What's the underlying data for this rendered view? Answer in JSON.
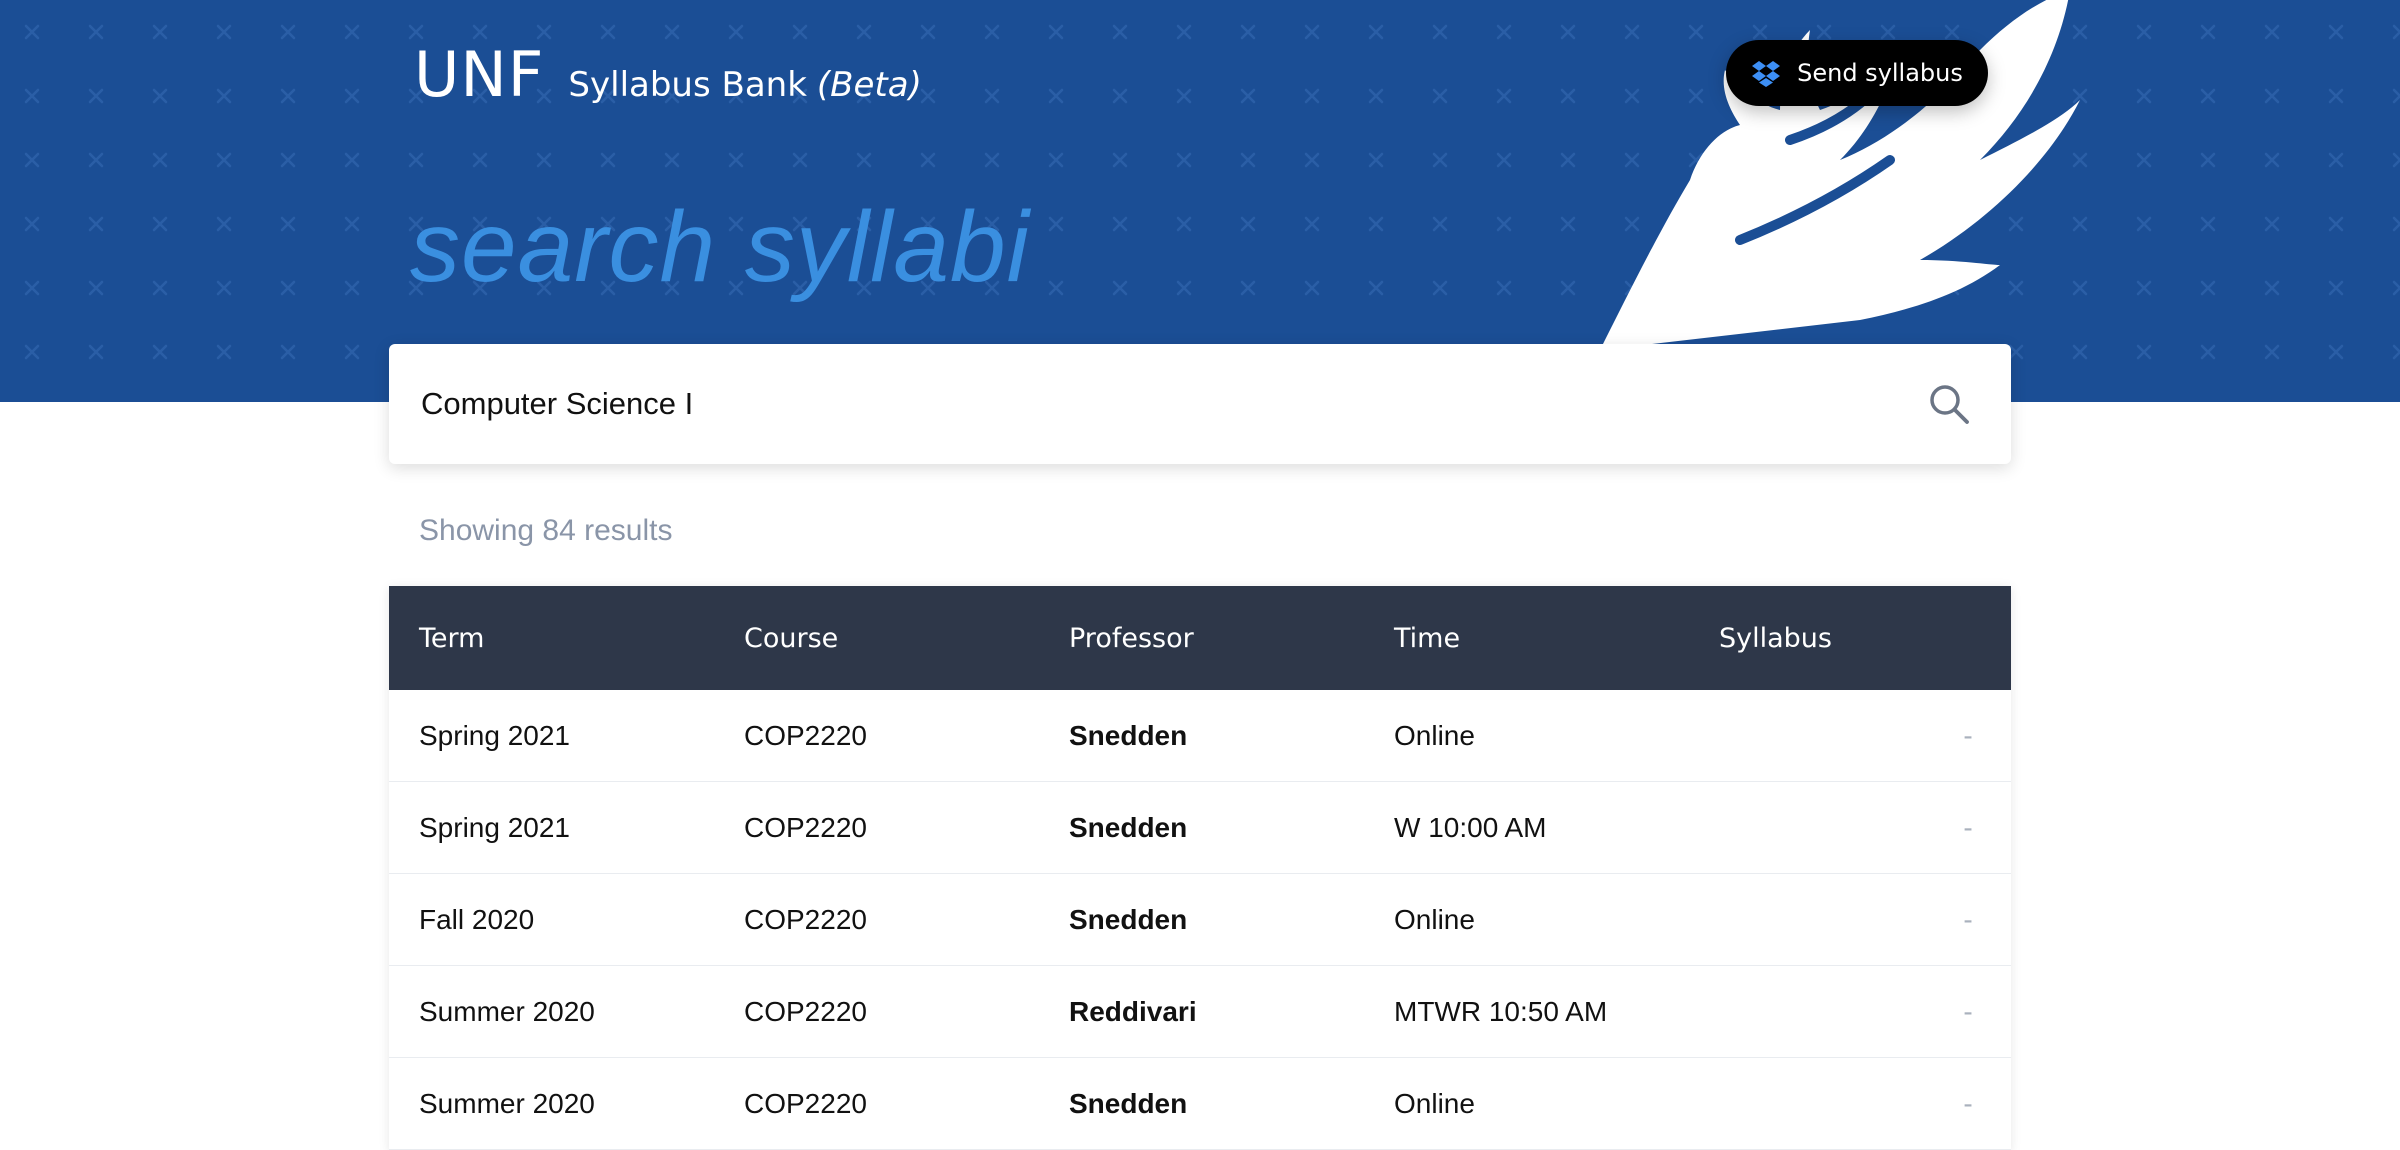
{
  "brand": {
    "logo": "UNF",
    "name": "Syllabus Bank",
    "beta": "(Beta)"
  },
  "header": {
    "send_button": {
      "label": "Send syllabus",
      "icon": "dropbox-icon"
    }
  },
  "hero": {
    "title": "search syllabi"
  },
  "search": {
    "value": "Computer Science I",
    "icon": "search-icon"
  },
  "results": {
    "count_text": "Showing 84 results"
  },
  "table": {
    "columns": [
      "Term",
      "Course",
      "Professor",
      "Time",
      "Syllabus"
    ],
    "rows": [
      {
        "term": "Spring 2021",
        "course": "COP2220",
        "professor": "Snedden",
        "time": "Online",
        "syllabus": "-"
      },
      {
        "term": "Spring 2021",
        "course": "COP2220",
        "professor": "Snedden",
        "time": "W 10:00 AM",
        "syllabus": "-"
      },
      {
        "term": "Fall 2020",
        "course": "COP2220",
        "professor": "Snedden",
        "time": "Online",
        "syllabus": "-"
      },
      {
        "term": "Summer 2020",
        "course": "COP2220",
        "professor": "Reddivari",
        "time": "MTWR 10:50 AM",
        "syllabus": "-"
      },
      {
        "term": "Summer 2020",
        "course": "COP2220",
        "professor": "Snedden",
        "time": "Online",
        "syllabus": "-"
      }
    ]
  },
  "colors": {
    "hero_blue": "#1b4e95",
    "title_blue": "#3a8fe0",
    "table_header": "#2e3749",
    "muted_text": "#8a95a8"
  }
}
